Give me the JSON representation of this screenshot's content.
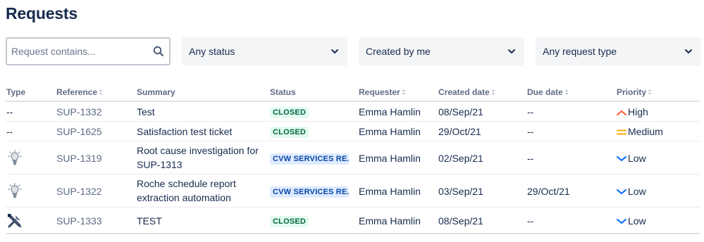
{
  "page": {
    "title": "Requests"
  },
  "filters": {
    "search_placeholder": "Request contains...",
    "status": "Any status",
    "created_by": "Created by me",
    "request_type": "Any request type"
  },
  "table": {
    "headers": {
      "type": "Type",
      "reference": "Reference",
      "summary": "Summary",
      "status": "Status",
      "requester": "Requester",
      "created": "Created date",
      "due": "Due date",
      "priority": "Priority"
    },
    "rows": [
      {
        "type": "--",
        "type_icon": "",
        "reference": "SUP-1332",
        "summary": "Test",
        "status": "CLOSED",
        "status_kind": "closed",
        "requester": "Emma Hamlin",
        "created": "08/Sep/21",
        "due": "--",
        "priority": "High",
        "priority_icon": "priority-high-icon"
      },
      {
        "type": "--",
        "type_icon": "",
        "reference": "SUP-1625",
        "summary": "Satisfaction test ticket",
        "status": "CLOSED",
        "status_kind": "closed",
        "requester": "Emma Hamlin",
        "created": "29/Oct/21",
        "due": "--",
        "priority": "Medium",
        "priority_icon": "priority-medium-icon"
      },
      {
        "type": "",
        "type_icon": "lightbulb-icon",
        "reference": "SUP-1319",
        "summary": "Root cause investigation for SUP-1313",
        "status": "CVW SERVICES RE...",
        "status_kind": "in-progress",
        "requester": "Emma Hamlin",
        "created": "02/Sep/21",
        "due": "--",
        "priority": "Low",
        "priority_icon": "priority-low-icon"
      },
      {
        "type": "",
        "type_icon": "lightbulb-icon",
        "reference": "SUP-1322",
        "summary": "Roche schedule report extraction automation",
        "status": "CVW SERVICES RE...",
        "status_kind": "in-progress",
        "requester": "Emma Hamlin",
        "created": "03/Sep/21",
        "due": "29/Oct/21",
        "priority": "Low",
        "priority_icon": "priority-low-icon"
      },
      {
        "type": "",
        "type_icon": "tools-icon",
        "reference": "SUP-1333",
        "summary": "TEST",
        "status": "CLOSED",
        "status_kind": "closed",
        "requester": "Emma Hamlin",
        "created": "08/Sep/21",
        "due": "--",
        "priority": "Low",
        "priority_icon": "priority-low-icon"
      }
    ]
  },
  "colors": {
    "closed_bg": "#e3fcef",
    "closed_fg": "#006644",
    "blue_bg": "#deebff",
    "blue_fg": "#0747a6",
    "high": "#ff5630",
    "medium": "#ffab00",
    "low": "#0065ff"
  }
}
